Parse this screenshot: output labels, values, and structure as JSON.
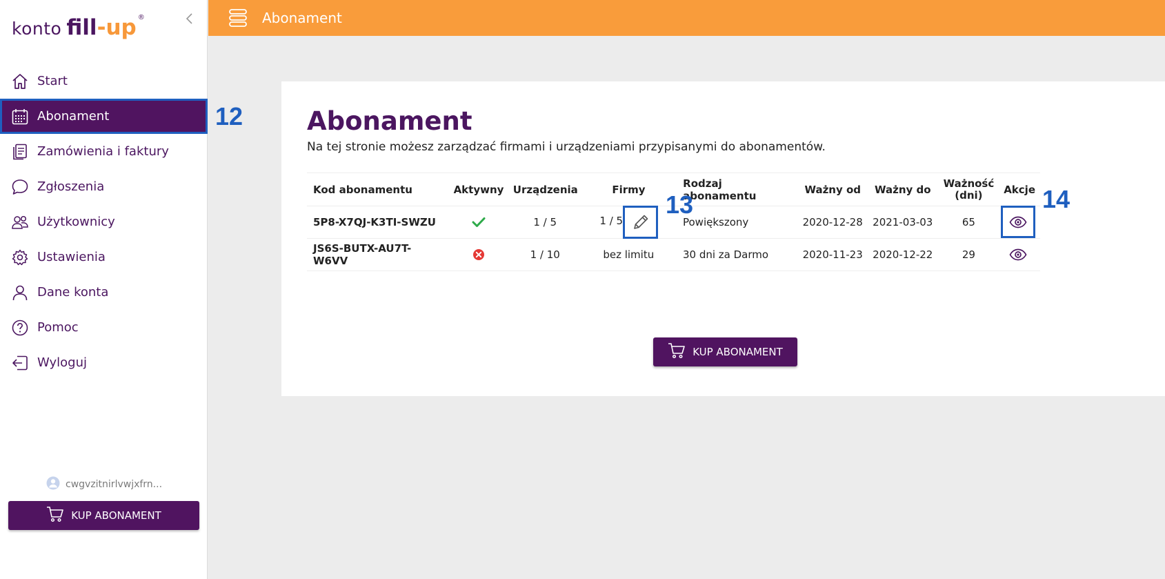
{
  "logo": {
    "konto": "konto",
    "fill": "fill",
    "dash": "-",
    "up": "up",
    "reg": "®"
  },
  "sidebar": {
    "items": [
      {
        "label": "Start",
        "icon": "home-icon"
      },
      {
        "label": "Abonament",
        "icon": "calendar-icon",
        "active": true
      },
      {
        "label": "Zamówienia i faktury",
        "icon": "documents-icon"
      },
      {
        "label": "Zgłoszenia",
        "icon": "chat-bubble-icon"
      },
      {
        "label": "Użytkownicy",
        "icon": "users-icon"
      },
      {
        "label": "Ustawienia",
        "icon": "gear-icon"
      },
      {
        "label": "Dane konta",
        "icon": "user-icon"
      },
      {
        "label": "Pomoc",
        "icon": "help-icon"
      },
      {
        "label": "Wyloguj",
        "icon": "logout-icon"
      }
    ],
    "user": "cwgvzitnirlvwjxfrn...",
    "buy_label": "KUP ABONAMENT"
  },
  "header": {
    "title": "Abonament"
  },
  "main": {
    "title": "Abonament",
    "description": "Na tej stronie możesz zarządzać firmami i urządzeniami przypisanymi do abonamentów.",
    "columns": {
      "code": "Kod abonamentu",
      "active": "Aktywny",
      "devices": "Urządzenia",
      "companies": "Firmy",
      "type": "Rodzaj abonamentu",
      "valid_from": "Ważny od",
      "valid_to": "Ważny do",
      "validity_1": "Ważność",
      "validity_2": "(dni)",
      "actions": "Akcje"
    },
    "rows": [
      {
        "code": "5P8-X7QJ-K3TI-SWZU",
        "active": true,
        "devices": "1 / 5",
        "companies": "1 / 5",
        "type": "Powiększony",
        "valid_from": "2020-12-28",
        "valid_to": "2021-03-03",
        "validity": "65"
      },
      {
        "code": "JS6S-BUTX-AU7T-W6VV",
        "active": false,
        "devices": "1 / 10",
        "companies": "bez limitu",
        "type": "30 dni za Darmo",
        "valid_from": "2020-11-23",
        "valid_to": "2020-12-22",
        "validity": "29"
      }
    ],
    "buy_label": "KUP ABONAMENT"
  },
  "annotations": {
    "a12": "12",
    "a13": "13",
    "a14": "14"
  },
  "colors": {
    "brand_purple": "#501460",
    "brand_orange": "#f99c3b",
    "annotation_blue": "#1f5fbf",
    "check_green": "#2eaa4a",
    "error_red": "#e53935"
  }
}
